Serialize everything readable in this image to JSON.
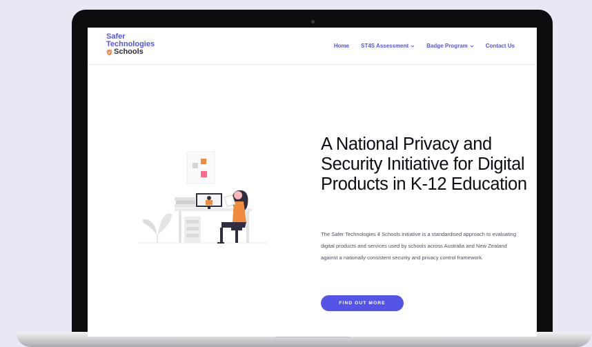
{
  "logo": {
    "line1": "Safer",
    "line2": "Technologies",
    "line3": "Schools"
  },
  "nav": {
    "items": [
      {
        "label": "Home"
      },
      {
        "label": "ST4S Assessment"
      },
      {
        "label": "Badge Program"
      },
      {
        "label": "Contact Us"
      }
    ]
  },
  "hero": {
    "title": "A National Privacy and Security Initiative for Digital Products in K-12 Education",
    "description": "The Safer Technologies 4 Schools initiative is a standardised approach to evaluating digital products and services used by schools across Australia and New Zealand against a nationally consistent security and privacy control framework.",
    "cta_label": "FIND OUT MORE"
  },
  "colors": {
    "accent": "#5454e6",
    "shield": "#f08a3c",
    "background": "#e8e7f3"
  },
  "icons": [
    "shield-icon",
    "chevron-down-icon",
    "person-at-desk-illustration"
  ]
}
